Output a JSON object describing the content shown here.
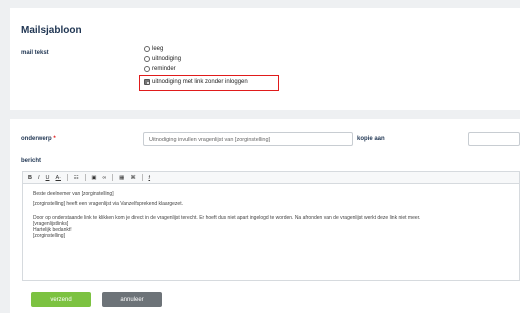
{
  "template_section": {
    "title": "Mailsjabloon",
    "label": "mail tekst",
    "options": [
      {
        "label": "leeg",
        "checked": false
      },
      {
        "label": "uitnodiging",
        "checked": false
      },
      {
        "label": "reminder",
        "checked": false
      },
      {
        "label": "uitnodiging met link zonder inloggen",
        "checked": true
      }
    ],
    "highlight_color": "#e01b1b"
  },
  "form": {
    "subject_label": "onderwerp",
    "required_marker": "*",
    "subject_value": "Uitnodiging invullen vragenlijst van [zorginstelling]",
    "cc_label": "kopie aan",
    "cc_value": "",
    "message_label": "bericht"
  },
  "toolbar": {
    "items": [
      {
        "icon": "bold-icon",
        "glyph": "B"
      },
      {
        "icon": "italic-icon",
        "glyph": "I"
      },
      {
        "icon": "underline-icon",
        "glyph": "U"
      },
      {
        "icon": "font-color-icon",
        "glyph": "A·"
      },
      {
        "icon": "list-icon",
        "glyph": "☷"
      },
      {
        "icon": "image-icon",
        "glyph": "▣"
      },
      {
        "icon": "link-icon",
        "glyph": "∞"
      },
      {
        "icon": "table-icon",
        "glyph": "▦"
      },
      {
        "icon": "source-icon",
        "glyph": "⌘"
      },
      {
        "icon": "clear-format-icon",
        "glyph": "Ɨ"
      }
    ]
  },
  "message": {
    "greeting": "Beste deelnemer van [zorginstelling]",
    "line1": "[zorginstelling] heeft een vragenlijst via Vanzelfsprekend klaargezet.",
    "line2": "Door op onderstaande link te klikken kom je direct in de vragenlijst terecht. Er hoeft dus niet apart ingelogd te worden. Na afronden van de vragenlijst werkt deze link niet meer.",
    "line3": "[vragenlijstlinks]",
    "line4": "Hartelijk bedankt!",
    "line5": "[zorginstelling]"
  },
  "buttons": {
    "send": "verzend",
    "cancel": "annuleer"
  },
  "colors": {
    "heading": "#1f3552",
    "send_button": "#7cc241",
    "cancel_button": "#6d7378",
    "required": "#e01b1b"
  }
}
